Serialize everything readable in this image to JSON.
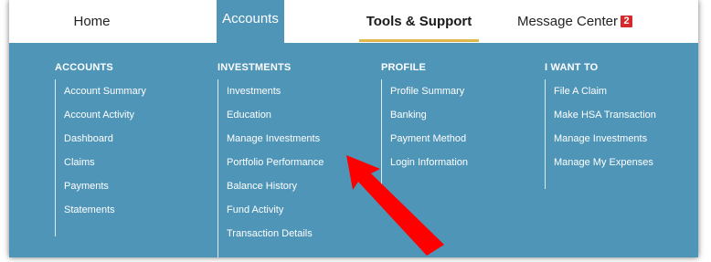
{
  "topnav": {
    "home": "Home",
    "accounts": "Accounts",
    "tools": "Tools & Support",
    "messages": "Message Center",
    "message_count": "2"
  },
  "menu": {
    "columns": [
      {
        "heading": "ACCOUNTS",
        "items": [
          "Account Summary",
          "Account Activity",
          "Dashboard",
          "Claims",
          "Payments",
          "Statements"
        ]
      },
      {
        "heading": "INVESTMENTS",
        "items": [
          "Investments",
          "Education",
          "Manage Investments",
          "Portfolio Performance",
          "Balance History",
          "Fund Activity",
          "Transaction Details"
        ]
      },
      {
        "heading": "PROFILE",
        "items": [
          "Profile Summary",
          "Banking",
          "Payment Method",
          "Login Information"
        ]
      },
      {
        "heading": "I WANT TO",
        "items": [
          "File A Claim",
          "Make HSA Transaction",
          "Manage Investments",
          "Manage My Expenses"
        ]
      }
    ]
  },
  "colors": {
    "panel": "#4f95b8",
    "active_tab_underline": "#e1b84a",
    "badge": "#d62a2a",
    "annotation_arrow": "#ff0000"
  },
  "annotation": {
    "icon": "red-arrow-annotation"
  }
}
